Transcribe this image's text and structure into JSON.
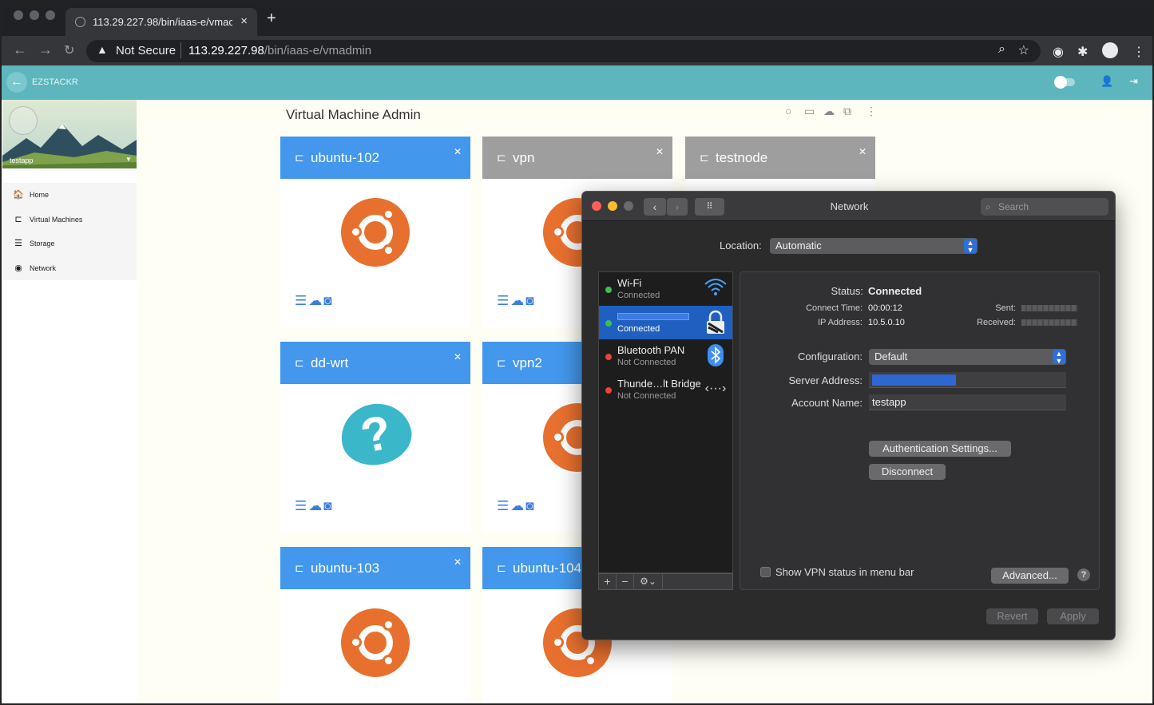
{
  "browser": {
    "tab_title": "113.29.227.98/bin/iaas-e/vmac",
    "tab_close": "×",
    "new_tab": "+",
    "security_label": "Not Secure",
    "url_host": "113.29.227.98",
    "url_path": "/bin/iaas-e/vmadmin"
  },
  "app": {
    "name": "EZSTACKR"
  },
  "sidebar": {
    "profile_name": "testapp",
    "items": [
      {
        "label": "Home",
        "icon": "home-icon",
        "glyph": "🏠"
      },
      {
        "label": "Virtual Machines",
        "icon": "laptop-icon",
        "glyph": "⊏"
      },
      {
        "label": "Storage",
        "icon": "storage-icon",
        "glyph": "☰"
      },
      {
        "label": "Network",
        "icon": "globe-icon",
        "glyph": "◉"
      }
    ]
  },
  "main": {
    "title": "Virtual Machine Admin",
    "vms": [
      {
        "name": "ubuntu-102",
        "state": "on",
        "os": "ubuntu"
      },
      {
        "name": "vpn",
        "state": "off",
        "os": "ubuntu"
      },
      {
        "name": "testnode",
        "state": "off",
        "os": "ubuntu"
      },
      {
        "name": "dd-wrt",
        "state": "on",
        "os": "unknown"
      },
      {
        "name": "vpn2",
        "state": "on",
        "os": "ubuntu"
      },
      {
        "name": "ubuntu-103",
        "state": "on",
        "os": "ubuntu"
      },
      {
        "name": "ubuntu-104",
        "state": "on",
        "os": "ubuntu"
      }
    ]
  },
  "network_window": {
    "title": "Network",
    "search_placeholder": "Search",
    "location_label": "Location:",
    "location_value": "Automatic",
    "services": [
      {
        "name": "Wi-Fi",
        "status": "Connected",
        "dot": "#3cc04b"
      },
      {
        "name": "",
        "status": "Connected",
        "dot": "#3cc04b"
      },
      {
        "name": "Bluetooth PAN",
        "status": "Not Connected",
        "dot": "#e5453b"
      },
      {
        "name": "Thunde…lt Bridge",
        "status": "Not Connected",
        "dot": "#e5453b"
      }
    ],
    "status_label": "Status:",
    "status_value": "Connected",
    "connect_time_label": "Connect Time:",
    "connect_time_value": "00:00:12",
    "ip_label": "IP Address:",
    "ip_value": "10.5.0.10",
    "sent_label": "Sent:",
    "received_label": "Received:",
    "configuration_label": "Configuration:",
    "configuration_value": "Default",
    "server_address_label": "Server Address:",
    "account_name_label": "Account Name:",
    "account_name_value": "testapp",
    "auth_button": "Authentication Settings...",
    "disconnect_button": "Disconnect",
    "show_vpn_label": "Show VPN status in menu bar",
    "advanced_button": "Advanced...",
    "help": "?",
    "revert_button": "Revert",
    "apply_button": "Apply"
  }
}
